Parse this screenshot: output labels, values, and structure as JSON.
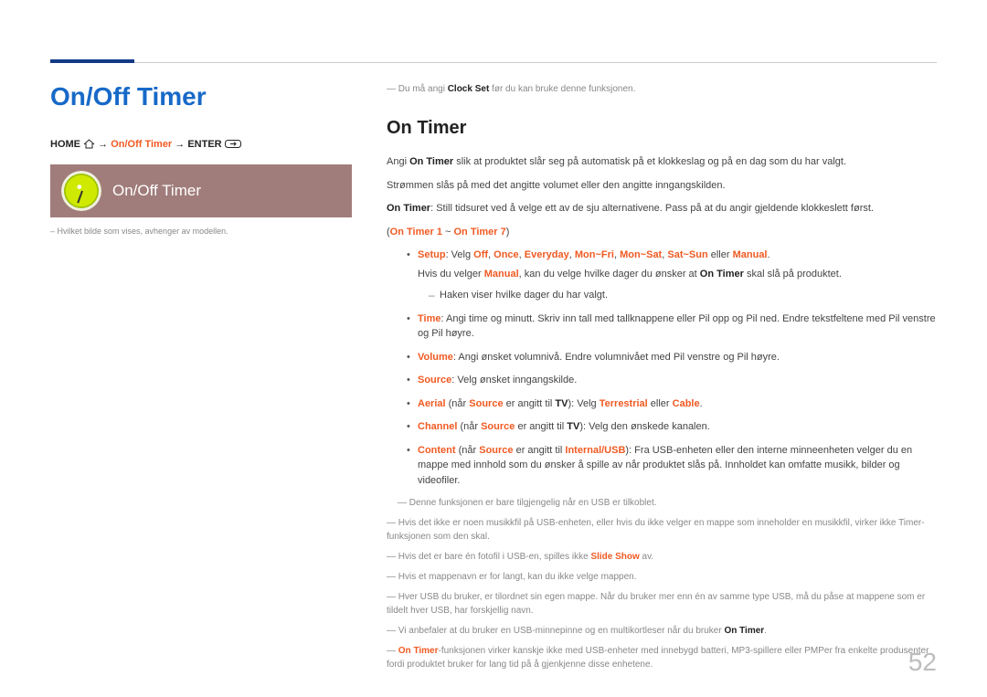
{
  "title": "On/Off Timer",
  "breadcrumb": {
    "home": "HOME",
    "arrow1": " → ",
    "mid": "On/Off Timer",
    "arrow2": " → ",
    "enter": "ENTER"
  },
  "tile_label": "On/Off Timer",
  "left_footnote": "Hvilket bilde som vises, avhenger av modellen.",
  "top_note_pre": "Du må angi ",
  "top_note_b": "Clock Set",
  "top_note_post": " før du kan bruke denne funksjonen.",
  "h2": "On Timer",
  "intro1_a": "Angi ",
  "intro1_b": "On Timer",
  "intro1_c": " slik at produktet slår seg på automatisk på et klokkeslag og på en dag som du har valgt.",
  "intro2": "Strømmen slås på med det angitte volumet eller den angitte inngangskilden.",
  "intro3_a": "On Timer",
  "intro3_b": ": Still tidsuret ved å velge ett av de sju alternativene. Pass på at du angir gjeldende klokkeslett først.",
  "range_a": "(",
  "range_b": "On Timer 1",
  "range_c": " ~ ",
  "range_d": "On Timer 7",
  "range_e": ")",
  "setup": {
    "label": "Setup",
    "velg": ": Velg ",
    "off": "Off",
    "c1": ", ",
    "once": "Once",
    "c2": ", ",
    "everyday": "Everyday",
    "c3": ", ",
    "monfri": "Mon~Fri",
    "c4": ", ",
    "monsat": "Mon~Sat",
    "c5": ", ",
    "satsun": "Sat~Sun",
    "eller": " eller ",
    "manual": "Manual",
    "dot": ".",
    "line2a": "Hvis du velger ",
    "line2b": "Manual",
    "line2c": ", kan du velge hvilke dager du ønsker at ",
    "line2d": "On Timer",
    "line2e": " skal slå på produktet.",
    "hake": "Haken viser hvilke dager du har valgt."
  },
  "time": {
    "label": "Time",
    "text": ": Angi time og minutt. Skriv inn tall med tallknappene eller Pil opp og Pil ned. Endre tekstfeltene med Pil venstre og Pil høyre."
  },
  "volume": {
    "label": "Volume",
    "text": ": Angi ønsket volumnivå. Endre volumnivået med Pil venstre og Pil høyre."
  },
  "source": {
    "label": "Source",
    "text": ": Velg ønsket inngangskilde."
  },
  "aerial": {
    "label": "Aerial",
    "a": " (når ",
    "src": "Source",
    "b": " er angitt til ",
    "tv": "TV",
    "c": "): Velg ",
    "terr": "Terrestrial",
    "d": " eller ",
    "cable": "Cable",
    "e": "."
  },
  "channel": {
    "label": "Channel",
    "a": " (når ",
    "src": "Source",
    "b": " er angitt til ",
    "tv": "TV",
    "c": "): Velg den ønskede kanalen."
  },
  "content": {
    "label": "Content",
    "a": " (når ",
    "src": "Source",
    "b": " er angitt til ",
    "iu": "Internal/USB",
    "c": "): Fra USB-enheten eller den interne minneenheten velger du en mappe med innhold som du ønsker å spille av når produktet slås på. Innholdet kan omfatte musikk, bilder og videofiler."
  },
  "notes": {
    "n1": "Denne funksjonen er bare tilgjengelig når en USB er tilkoblet.",
    "n2": "Hvis det ikke er noen musikkfil på USB-enheten, eller hvis du ikke velger en mappe som inneholder en musikkfil, virker ikke Timer-funksjonen som den skal.",
    "n3a": "Hvis det er bare én fotofil i USB-en, spilles ikke ",
    "n3b": "Slide Show",
    "n3c": " av.",
    "n4": "Hvis et mappenavn er for langt, kan du ikke velge mappen.",
    "n5": "Hver USB du bruker, er tilordnet sin egen mappe. Når du bruker mer enn én av samme type USB, må du påse at mappene som er tildelt hver USB, har forskjellig navn.",
    "n6a": "Vi anbefaler at du bruker en USB-minnepinne og en multikortleser når du bruker ",
    "n6b": "On Timer",
    "n6c": ".",
    "n7a": "On Timer",
    "n7b": "-funksjonen virker kanskje ikke med USB-enheter med innebygd batteri, MP3-spillere eller PMPer fra enkelte produsenter fordi produktet bruker for lang tid på å gjenkjenne disse enhetene."
  },
  "pagenum": "52"
}
